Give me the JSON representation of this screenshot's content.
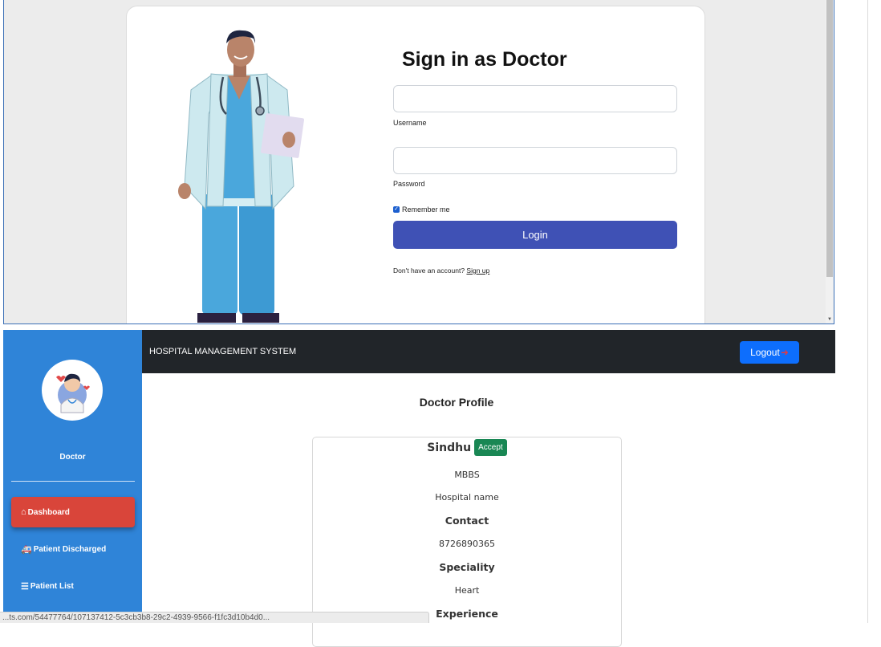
{
  "login": {
    "title": "Sign in as Doctor",
    "username_label": "Username",
    "username_value": "",
    "password_label": "Password",
    "password_value": "",
    "remember_label": "Remember me",
    "remember_checked": true,
    "login_button": "Login",
    "signup_prompt": "Don't have an account?",
    "signup_link": "Sign up"
  },
  "header": {
    "brand": "HOSPITAL MANAGEMENT SYSTEM",
    "logout_label": "Logout",
    "logout_icon": "sign-out-icon"
  },
  "sidebar": {
    "role": "Doctor",
    "items": [
      {
        "label": "Dashboard",
        "icon": "home-icon",
        "active": true
      },
      {
        "label": "Patient Discharged",
        "icon": "ambulance-icon",
        "active": false
      },
      {
        "label": "Patient List",
        "icon": "list-icon",
        "active": false
      }
    ]
  },
  "profile": {
    "page_title": "Doctor Profile",
    "name": "Sindhu",
    "status_badge": "Accept",
    "degree": "MBBS",
    "hospital": "Hospital name",
    "contact_heading": "Contact",
    "contact": "8726890365",
    "speciality_heading": "Speciality",
    "speciality": "Heart",
    "experience_heading": "Experience"
  },
  "status_bar": {
    "url": "...ts.com/54477764/107137412-5c3cb3b8-29c2-4939-9566-f1fc3d10b4d0..."
  },
  "colors": {
    "sidebar": "#2f84d8",
    "active_item": "#d9453a",
    "topbar": "#212529",
    "login_button": "#3f51b5",
    "logout_button": "#0d6efd",
    "accept_badge": "#198754"
  }
}
